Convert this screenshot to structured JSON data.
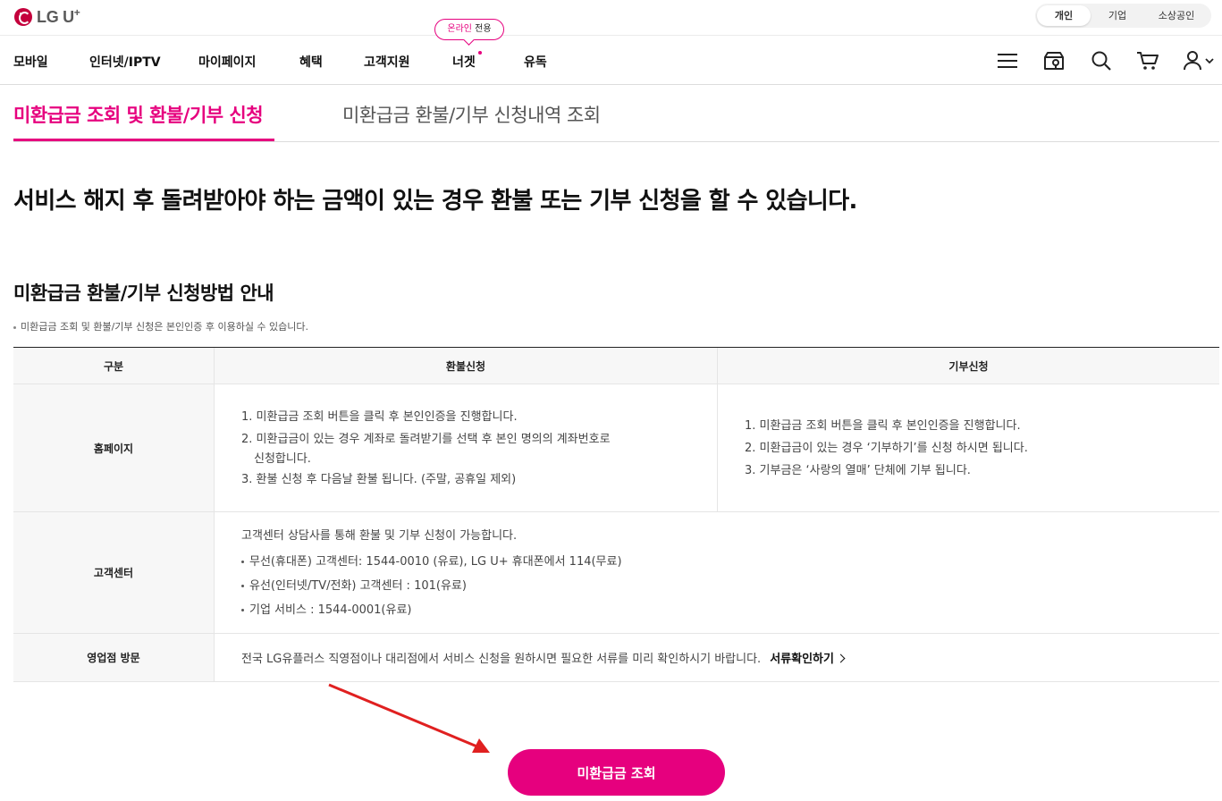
{
  "brand": {
    "logo_text": "LG U",
    "logo_sup": "+"
  },
  "segments": [
    "개인",
    "기업",
    "소상공인"
  ],
  "nav": {
    "items": [
      "모바일",
      "인터넷/IPTV",
      "마이페이지",
      "혜택",
      "고객지원",
      "너겟",
      "유독"
    ],
    "online_badge_pink": "온라인",
    "online_badge_rest": " 전용",
    "icons": [
      "menu-icon",
      "store-map-icon",
      "search-icon",
      "cart-icon",
      "user-icon"
    ]
  },
  "tabs": [
    "미환급금 조회 및 환불/기부 신청",
    "미환급금 환불/기부 신청내역 조회"
  ],
  "headline": "서비스 해지 후 돌려받아야 하는 금액이 있는 경우 환불 또는 기부 신청을 할 수 있습니다.",
  "section": {
    "title": "미환급금 환불/기부 신청방법 안내",
    "note": "미환급금 조회 및 환불/기부 신청은 본인인증 후 이용하실 수 있습니다."
  },
  "table": {
    "headers": [
      "구분",
      "환불신청",
      "기부신청"
    ],
    "rows": {
      "homepage": {
        "label": "홈페이지",
        "refund": [
          "1. 미환급금 조회 버튼을 클릭 후 본인인증을 진행합니다.",
          "2. 미환급금이 있는 경우 계좌로 돌려받기를 선택 후 본인 명의의 계좌번호로",
          "신청합니다.",
          "3. 환불 신청 후 다음날 환불 됩니다. (주말, 공휴일 제외)"
        ],
        "donate": [
          "1. 미환급금 조회 버튼을 클릭 후 본인인증을 진행합니다.",
          "2. 미환급금이 있는 경우 ‘기부하기’를 신청 하시면 됩니다.",
          "3. 기부금은 ‘사랑의 열매’ 단체에 기부 됩니다."
        ]
      },
      "center": {
        "label": "고객센터",
        "lead": "고객센터 상담사를 통해 환불 및 기부 신청이 가능합니다.",
        "items": [
          "무선(휴대폰) 고객센터: 1544-0010 (유료), LG U+ 휴대폰에서 114(무료)",
          "유선(인터넷/TV/전화) 고객센터 : 101(유료)",
          "기업 서비스 : 1544-0001(유료)"
        ]
      },
      "store": {
        "label": "영업점 방문",
        "text": "전국 LG유플러스 직영점이나 대리점에서 서비스 신청을 원하시면 필요한 서류를 미리 확인하시기 바랍니다.",
        "link": "서류확인하기"
      }
    }
  },
  "cta": {
    "label": "미환급금 조회"
  },
  "colors": {
    "accent": "#e6007e",
    "brand": "#c4003c",
    "annotation_arrow": "#e02020"
  }
}
